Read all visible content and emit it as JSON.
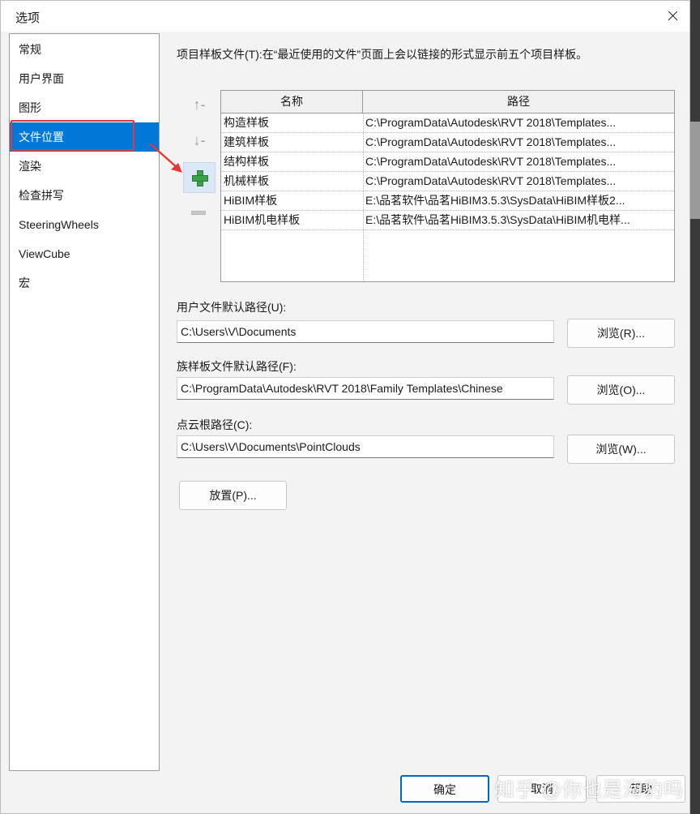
{
  "dialog": {
    "title": "选项"
  },
  "sidebar": {
    "items": [
      {
        "label": "常规"
      },
      {
        "label": "用户界面"
      },
      {
        "label": "图形"
      },
      {
        "label": "文件位置",
        "selected": true
      },
      {
        "label": "渲染"
      },
      {
        "label": "检查拼写"
      },
      {
        "label": "SteeringWheels"
      },
      {
        "label": "ViewCube"
      },
      {
        "label": "宏"
      }
    ]
  },
  "main": {
    "description": "项目样板文件(T):在“最近使用的文件”页面上会以链接的形式显示前五个项目样板。",
    "tools": {
      "up": "↑-",
      "down": "↓-"
    },
    "table": {
      "headers": {
        "name": "名称",
        "path": "路径"
      },
      "rows": [
        {
          "name": "构造样板",
          "path": "C:\\ProgramData\\Autodesk\\RVT 2018\\Templates..."
        },
        {
          "name": "建筑样板",
          "path": "C:\\ProgramData\\Autodesk\\RVT 2018\\Templates..."
        },
        {
          "name": "结构样板",
          "path": "C:\\ProgramData\\Autodesk\\RVT 2018\\Templates..."
        },
        {
          "name": "机械样板",
          "path": "C:\\ProgramData\\Autodesk\\RVT 2018\\Templates..."
        },
        {
          "name": "HiBIM样板",
          "path": "E:\\品茗软件\\品茗HiBIM3.5.3\\SysData\\HiBIM样板2..."
        },
        {
          "name": "HiBIM机电样板",
          "path": "E:\\品茗软件\\品茗HiBIM3.5.3\\SysData\\HiBIM机电样..."
        }
      ]
    },
    "user_path": {
      "label": "用户文件默认路径(U):",
      "value": "C:\\Users\\V\\Documents",
      "browse": "浏览(R)..."
    },
    "family_path": {
      "label": "族样板文件默认路径(F):",
      "value": "C:\\ProgramData\\Autodesk\\RVT 2018\\Family Templates\\Chinese",
      "browse": "浏览(O)..."
    },
    "cloud_path": {
      "label": "点云根路径(C):",
      "value": "C:\\Users\\V\\Documents\\PointClouds",
      "browse": "浏览(W)..."
    },
    "place_button": "放置(P)..."
  },
  "footer": {
    "ok": "确定",
    "cancel": "取消",
    "help": "帮助"
  },
  "watermark": "知乎 @你也是海豹吗",
  "colors": {
    "accent": "#0078d7",
    "highlight": "#e53935",
    "add_icon": "#3aa34a"
  }
}
